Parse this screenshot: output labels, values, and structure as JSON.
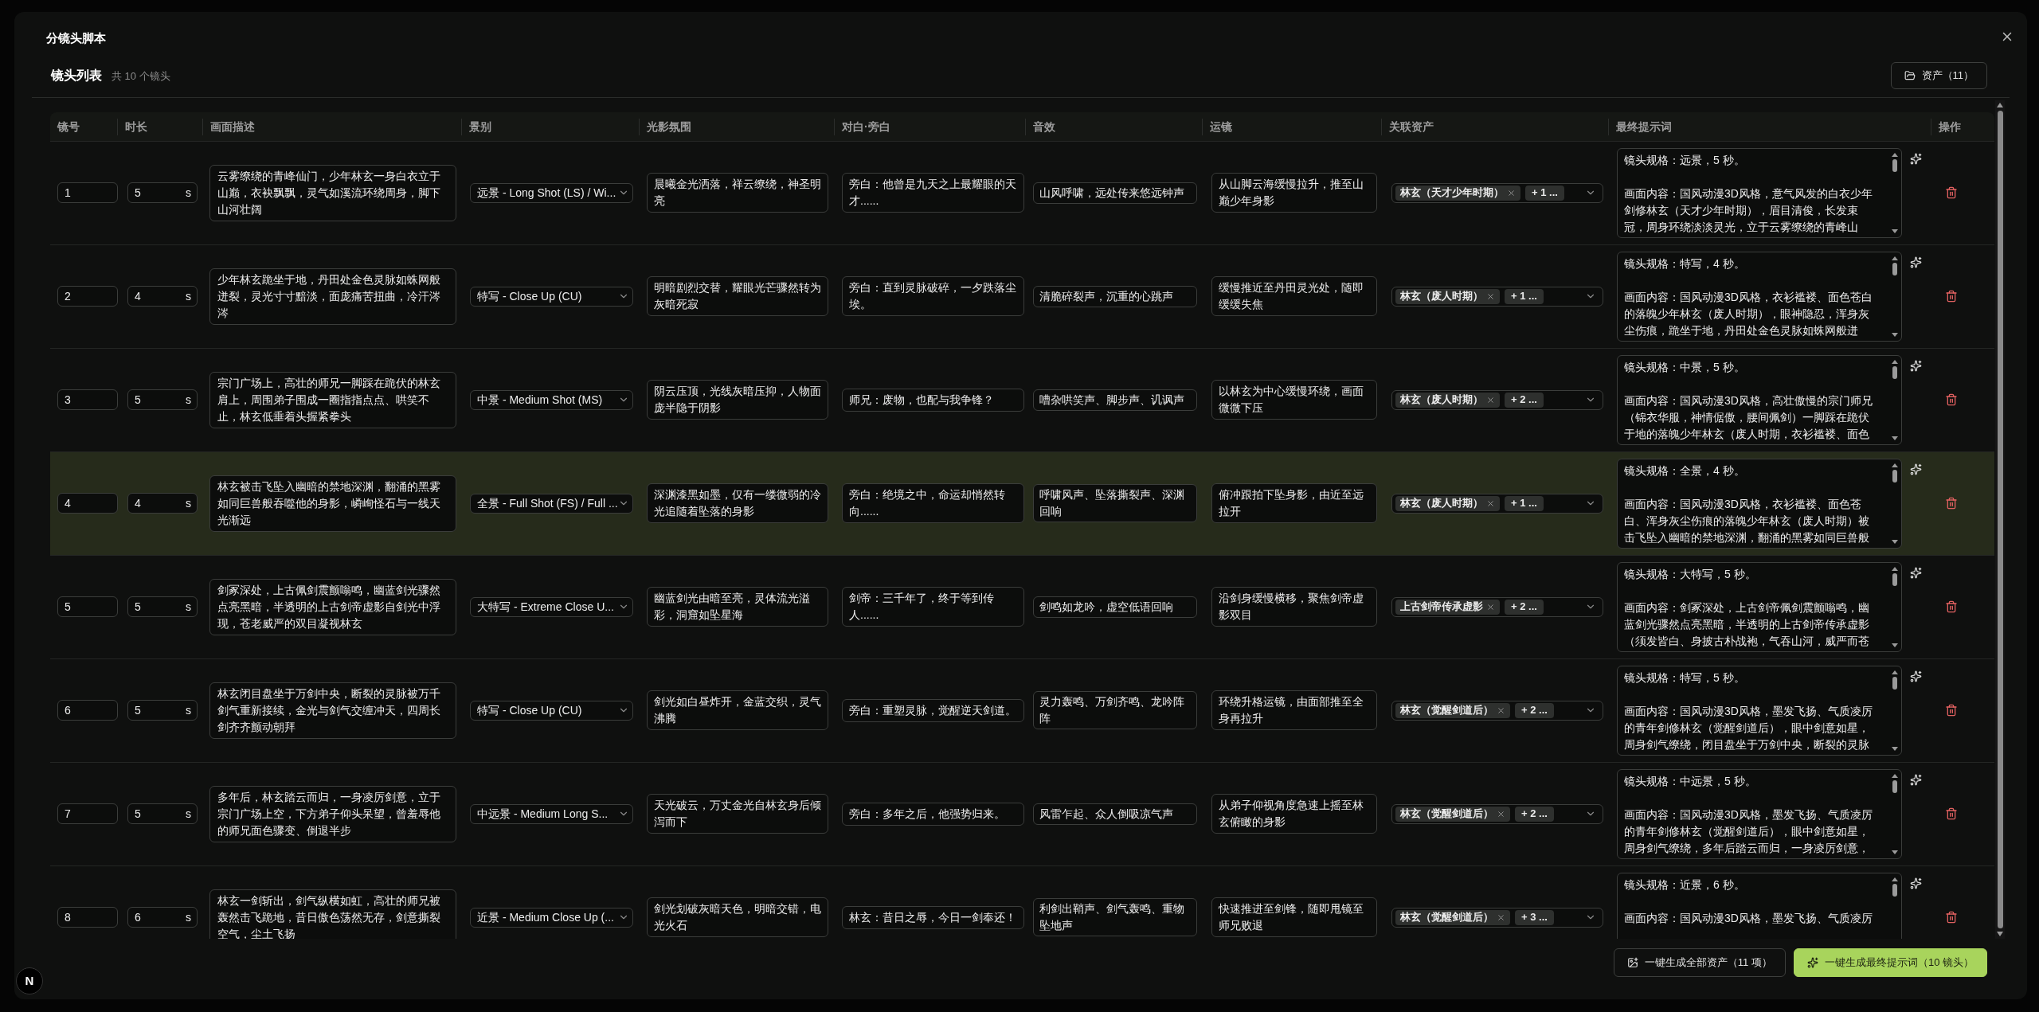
{
  "dialog": {
    "title": "分镜头脚本"
  },
  "section": {
    "title": "镜头列表",
    "count": "共 10 个镜头",
    "assets_button": "资产（11）"
  },
  "table": {
    "columns": [
      "镜号",
      "时长",
      "画面描述",
      "景别",
      "光影氛围",
      "对白·旁白",
      "音效",
      "运镜",
      "关联资产",
      "最终提示词",
      "操作"
    ],
    "rows": [
      {
        "selected": false,
        "number": "1",
        "duration": "5",
        "unit": "s",
        "description": "云雾缭绕的青峰仙门，少年林玄一身白衣立于山巅，衣袂飘飘，灵气如溪流环绕周身，脚下山河壮阔",
        "shot_type": "远景 - Long Shot (LS) / Wi...",
        "lighting": "晨曦金光洒落，祥云缭绕，神圣明亮",
        "dialogue": "旁白：他曾是九天之上最耀眼的天才......",
        "sound": "山风呼啸，远处传来悠远钟声",
        "camera": "从山脚云海缓慢拉升，推至山巅少年身影",
        "asset_tag": "林玄（天才少年时期）",
        "asset_more": "+ 1 ...",
        "prompt_spec": "镜头规格：远景，5 秒。",
        "prompt_content": "画面内容：国风动漫3D风格，意气风发的白衣少年剑修林玄（天才少年时期），眉目清俊，长发束冠，周身环绕淡淡灵光，立于云雾缭绕的青峰山"
      },
      {
        "selected": false,
        "number": "2",
        "duration": "4",
        "unit": "s",
        "description": "少年林玄跪坐于地，丹田处金色灵脉如蛛网般迸裂，灵光寸寸黯淡，面庞痛苦扭曲，冷汗涔涔",
        "shot_type": "特写 - Close Up (CU)",
        "lighting": "明暗剧烈交替，耀眼光芒骤然转为灰暗死寂",
        "dialogue": "旁白：直到灵脉破碎，一夕跌落尘埃。",
        "sound": "清脆碎裂声，沉重的心跳声",
        "camera": "缓慢推近至丹田灵光处，随即缓缓失焦",
        "asset_tag": "林玄（废人时期）",
        "asset_more": "+ 1 ...",
        "prompt_spec": "镜头规格：特写，4 秒。",
        "prompt_content": "画面内容：国风动漫3D风格，衣衫褴褛、面色苍白的落魄少年林玄（废人时期），眼神隐忍，浑身灰尘伤痕，跪坐于地，丹田处金色灵脉如蛛网般迸"
      },
      {
        "selected": false,
        "number": "3",
        "duration": "5",
        "unit": "s",
        "description": "宗门广场上，高壮的师兄一脚踩在跪伏的林玄肩上，周围弟子围成一圈指指点点、哄笑不止，林玄低垂着头握紧拳头",
        "shot_type": "中景 - Medium Shot (MS)",
        "lighting": "阴云压顶，光线灰暗压抑，人物面庞半隐于阴影",
        "dialogue": "师兄：废物，也配与我争锋？",
        "sound": "嘈杂哄笑声、脚步声、讥讽声",
        "camera": "以林玄为中心缓慢环绕，画面微微下压",
        "asset_tag": "林玄（废人时期）",
        "asset_more": "+ 2 ...",
        "prompt_spec": "镜头规格：中景，5 秒。",
        "prompt_content": "画面内容：国风动漫3D风格，高壮傲慢的宗门师兄（锦衣华服，神情倨傲，腰间佩剑）一脚踩在跪伏于地的落魄少年林玄（废人时期，衣衫褴褛、面色"
      },
      {
        "selected": true,
        "number": "4",
        "duration": "4",
        "unit": "s",
        "description": "林玄被击飞坠入幽暗的禁地深渊，翻涌的黑雾如同巨兽般吞噬他的身影，嶙峋怪石与一线天光渐远",
        "shot_type": "全景 - Full Shot (FS) / Full ...",
        "lighting": "深渊漆黑如墨，仅有一缕微弱的冷光追随着坠落的身影",
        "dialogue": "旁白：绝境之中，命运却悄然转向......",
        "sound": "呼啸风声、坠落撕裂声、深渊回响",
        "camera": "俯冲跟拍下坠身影，由近至远拉开",
        "asset_tag": "林玄（废人时期）",
        "asset_more": "+ 1 ...",
        "prompt_spec": "镜头规格：全景，4 秒。",
        "prompt_content": "画面内容：国风动漫3D风格，衣衫褴褛、面色苍白、浑身灰尘伤痕的落魄少年林玄（废人时期）被击飞坠入幽暗的禁地深渊，翻涌的黑雾如同巨兽般"
      },
      {
        "selected": false,
        "number": "5",
        "duration": "5",
        "unit": "s",
        "description": "剑冢深处，上古佩剑震颤嗡鸣，幽蓝剑光骤然点亮黑暗，半透明的上古剑帝虚影自剑光中浮现，苍老威严的双目凝视林玄",
        "shot_type": "大特写 - Extreme Close U...",
        "lighting": "幽蓝剑光由暗至亮，灵体流光溢彩，洞窟如坠星海",
        "dialogue": "剑帝：三千年了，终于等到传人......",
        "sound": "剑鸣如龙吟，虚空低语回响",
        "camera": "沿剑身缓慢横移，聚焦剑帝虚影双目",
        "asset_tag": "上古剑帝传承虚影",
        "asset_more": "+ 2 ...",
        "prompt_spec": "镜头规格：大特写，5 秒。",
        "prompt_content": "画面内容：剑冢深处，上古剑帝佩剑震颤嗡鸣，幽蓝剑光骤然点亮黑暗，半透明的上古剑帝传承虚影（须发皆白、身披古朴战袍，气吞山河，威严而苍"
      },
      {
        "selected": false,
        "number": "6",
        "duration": "5",
        "unit": "s",
        "description": "林玄闭目盘坐于万剑中央，断裂的灵脉被万千剑气重新接续，金光与剑气交缠冲天，四周长剑齐齐颤动朝拜",
        "shot_type": "特写 - Close Up (CU)",
        "lighting": "剑光如白昼炸开，金蓝交织，灵气沸腾",
        "dialogue": "旁白：重塑灵脉，觉醒逆天剑道。",
        "sound": "灵力轰鸣、万剑齐鸣、龙吟阵阵",
        "camera": "环绕升格运镜，由面部推至全身再拉升",
        "asset_tag": "林玄（觉醒剑道后）",
        "asset_more": "+ 2 ...",
        "prompt_spec": "镜头规格：特写，5 秒。",
        "prompt_content": "画面内容：国风动漫3D风格，墨发飞扬、气质凌厉的青年剑修林玄（觉醒剑道后），眼中剑意如星，周身剑气缭绕，闭目盘坐于万剑中央，断裂的灵脉"
      },
      {
        "selected": false,
        "number": "7",
        "duration": "5",
        "unit": "s",
        "description": "多年后，林玄踏云而归，一身凌厉剑意，立于宗门广场上空，下方弟子仰头呆望，曾羞辱他的师兄面色骤变、倒退半步",
        "shot_type": "中远景 - Medium Long S...",
        "lighting": "天光破云，万丈金光自林玄身后倾泻而下",
        "dialogue": "旁白：多年之后，他强势归来。",
        "sound": "风雷乍起、众人倒吸凉气声",
        "camera": "从弟子仰视角度急速上摇至林玄俯瞰的身影",
        "asset_tag": "林玄（觉醒剑道后）",
        "asset_more": "+ 2 ...",
        "prompt_spec": "镜头规格：中远景，5 秒。",
        "prompt_content": "画面内容：国风动漫3D风格，墨发飞扬、气质凌厉的青年剑修林玄（觉醒剑道后），眼中剑意如星，周身剑气缭绕，多年后踏云而归，一身凌厉剑意，"
      },
      {
        "selected": false,
        "number": "8",
        "duration": "6",
        "unit": "s",
        "description": "林玄一剑斩出，剑气纵横如虹，高壮的师兄被轰然击飞跪地，昔日傲色荡然无存，剑意撕裂空气，尘土飞扬",
        "shot_type": "近景 - Medium Close Up (...",
        "lighting": "剑光划破灰暗天色，明暗交错，电光火石",
        "dialogue": "林玄：昔日之辱，今日一剑奉还！",
        "sound": "利剑出鞘声、剑气轰鸣、重物坠地声",
        "camera": "快速推进至剑锋，随即甩镜至师兄败退",
        "asset_tag": "林玄（觉醒剑道后）",
        "asset_more": "+ 3 ...",
        "prompt_spec": "镜头规格：近景，6 秒。",
        "prompt_content": "画面内容：国风动漫3D风格，墨发飞扬、气质凌厉"
      }
    ]
  },
  "footer": {
    "buttons": [
      {
        "kind": "secondary",
        "label": "一键生成全部资产（11 项）"
      },
      {
        "kind": "primary",
        "label": "一键生成最终提示词（10 镜头）"
      }
    ]
  },
  "badge": "N"
}
